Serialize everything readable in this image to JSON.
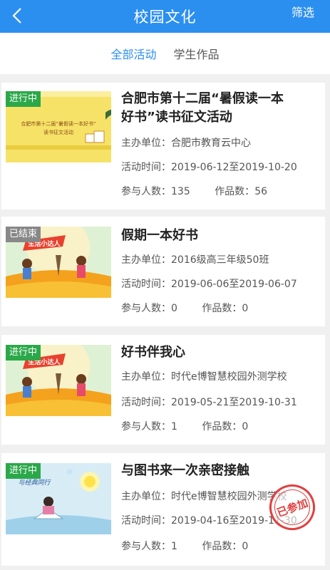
{
  "header": {
    "title": "校园文化",
    "filter_label": "筛选",
    "back_icon": "chevron-left-icon",
    "background": "#2b8ff0"
  },
  "tabs": [
    {
      "label": "全部活动",
      "active": true
    },
    {
      "label": "学生作品",
      "active": false
    }
  ],
  "labels": {
    "host": "主办单位：",
    "time": "活动时间：",
    "participants": "参与人数：",
    "works": "作品数："
  },
  "activities": [
    {
      "status": "进行中",
      "title_line1": "合肥市第十二届“暑假读一本",
      "title_line2": "好书”读书征文活动",
      "host": "合肥市教育云中心",
      "time": "2019-06-12至2019-10-20",
      "participants": "135",
      "works": "56",
      "thumb_text1": "合肥市第十二届“暑假读一本好书”",
      "thumb_text2": "读书征文活动"
    },
    {
      "status": "已结束",
      "title_line1": "假期一本好书",
      "host": "2016级高三年级50班",
      "time": "2019-06-06至2019-06-07",
      "participants": "0",
      "works": "0",
      "thumb_text1": "生活小达人"
    },
    {
      "status": "进行中",
      "title_line1": "好书伴我心",
      "host": "时代e博智慧校园外测学校",
      "time": "2019-05-21至2019-10-31",
      "participants": "1",
      "works": "0",
      "thumb_text1": "生活小达人"
    },
    {
      "status": "进行中",
      "title_line1": "与图书来一次亲密接触",
      "host": "时代e博智慧校园外测学校",
      "time": "2019-04-16至2019-11-30",
      "participants": "1",
      "works": "0",
      "thumb_text1": "与经典同行",
      "stamp": "已参加"
    }
  ]
}
